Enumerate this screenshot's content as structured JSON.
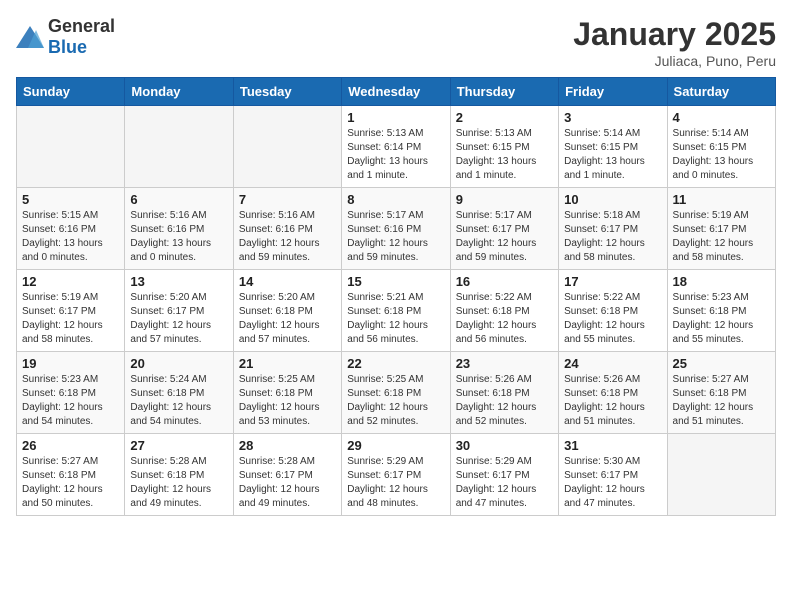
{
  "logo": {
    "general": "General",
    "blue": "Blue"
  },
  "header": {
    "title": "January 2025",
    "subtitle": "Juliaca, Puno, Peru"
  },
  "weekdays": [
    "Sunday",
    "Monday",
    "Tuesday",
    "Wednesday",
    "Thursday",
    "Friday",
    "Saturday"
  ],
  "weeks": [
    [
      {
        "day": "",
        "info": ""
      },
      {
        "day": "",
        "info": ""
      },
      {
        "day": "",
        "info": ""
      },
      {
        "day": "1",
        "info": "Sunrise: 5:13 AM\nSunset: 6:14 PM\nDaylight: 13 hours\nand 1 minute."
      },
      {
        "day": "2",
        "info": "Sunrise: 5:13 AM\nSunset: 6:15 PM\nDaylight: 13 hours\nand 1 minute."
      },
      {
        "day": "3",
        "info": "Sunrise: 5:14 AM\nSunset: 6:15 PM\nDaylight: 13 hours\nand 1 minute."
      },
      {
        "day": "4",
        "info": "Sunrise: 5:14 AM\nSunset: 6:15 PM\nDaylight: 13 hours\nand 0 minutes."
      }
    ],
    [
      {
        "day": "5",
        "info": "Sunrise: 5:15 AM\nSunset: 6:16 PM\nDaylight: 13 hours\nand 0 minutes."
      },
      {
        "day": "6",
        "info": "Sunrise: 5:16 AM\nSunset: 6:16 PM\nDaylight: 13 hours\nand 0 minutes."
      },
      {
        "day": "7",
        "info": "Sunrise: 5:16 AM\nSunset: 6:16 PM\nDaylight: 12 hours\nand 59 minutes."
      },
      {
        "day": "8",
        "info": "Sunrise: 5:17 AM\nSunset: 6:16 PM\nDaylight: 12 hours\nand 59 minutes."
      },
      {
        "day": "9",
        "info": "Sunrise: 5:17 AM\nSunset: 6:17 PM\nDaylight: 12 hours\nand 59 minutes."
      },
      {
        "day": "10",
        "info": "Sunrise: 5:18 AM\nSunset: 6:17 PM\nDaylight: 12 hours\nand 58 minutes."
      },
      {
        "day": "11",
        "info": "Sunrise: 5:19 AM\nSunset: 6:17 PM\nDaylight: 12 hours\nand 58 minutes."
      }
    ],
    [
      {
        "day": "12",
        "info": "Sunrise: 5:19 AM\nSunset: 6:17 PM\nDaylight: 12 hours\nand 58 minutes."
      },
      {
        "day": "13",
        "info": "Sunrise: 5:20 AM\nSunset: 6:17 PM\nDaylight: 12 hours\nand 57 minutes."
      },
      {
        "day": "14",
        "info": "Sunrise: 5:20 AM\nSunset: 6:18 PM\nDaylight: 12 hours\nand 57 minutes."
      },
      {
        "day": "15",
        "info": "Sunrise: 5:21 AM\nSunset: 6:18 PM\nDaylight: 12 hours\nand 56 minutes."
      },
      {
        "day": "16",
        "info": "Sunrise: 5:22 AM\nSunset: 6:18 PM\nDaylight: 12 hours\nand 56 minutes."
      },
      {
        "day": "17",
        "info": "Sunrise: 5:22 AM\nSunset: 6:18 PM\nDaylight: 12 hours\nand 55 minutes."
      },
      {
        "day": "18",
        "info": "Sunrise: 5:23 AM\nSunset: 6:18 PM\nDaylight: 12 hours\nand 55 minutes."
      }
    ],
    [
      {
        "day": "19",
        "info": "Sunrise: 5:23 AM\nSunset: 6:18 PM\nDaylight: 12 hours\nand 54 minutes."
      },
      {
        "day": "20",
        "info": "Sunrise: 5:24 AM\nSunset: 6:18 PM\nDaylight: 12 hours\nand 54 minutes."
      },
      {
        "day": "21",
        "info": "Sunrise: 5:25 AM\nSunset: 6:18 PM\nDaylight: 12 hours\nand 53 minutes."
      },
      {
        "day": "22",
        "info": "Sunrise: 5:25 AM\nSunset: 6:18 PM\nDaylight: 12 hours\nand 52 minutes."
      },
      {
        "day": "23",
        "info": "Sunrise: 5:26 AM\nSunset: 6:18 PM\nDaylight: 12 hours\nand 52 minutes."
      },
      {
        "day": "24",
        "info": "Sunrise: 5:26 AM\nSunset: 6:18 PM\nDaylight: 12 hours\nand 51 minutes."
      },
      {
        "day": "25",
        "info": "Sunrise: 5:27 AM\nSunset: 6:18 PM\nDaylight: 12 hours\nand 51 minutes."
      }
    ],
    [
      {
        "day": "26",
        "info": "Sunrise: 5:27 AM\nSunset: 6:18 PM\nDaylight: 12 hours\nand 50 minutes."
      },
      {
        "day": "27",
        "info": "Sunrise: 5:28 AM\nSunset: 6:18 PM\nDaylight: 12 hours\nand 49 minutes."
      },
      {
        "day": "28",
        "info": "Sunrise: 5:28 AM\nSunset: 6:17 PM\nDaylight: 12 hours\nand 49 minutes."
      },
      {
        "day": "29",
        "info": "Sunrise: 5:29 AM\nSunset: 6:17 PM\nDaylight: 12 hours\nand 48 minutes."
      },
      {
        "day": "30",
        "info": "Sunrise: 5:29 AM\nSunset: 6:17 PM\nDaylight: 12 hours\nand 47 minutes."
      },
      {
        "day": "31",
        "info": "Sunrise: 5:30 AM\nSunset: 6:17 PM\nDaylight: 12 hours\nand 47 minutes."
      },
      {
        "day": "",
        "info": ""
      }
    ]
  ]
}
